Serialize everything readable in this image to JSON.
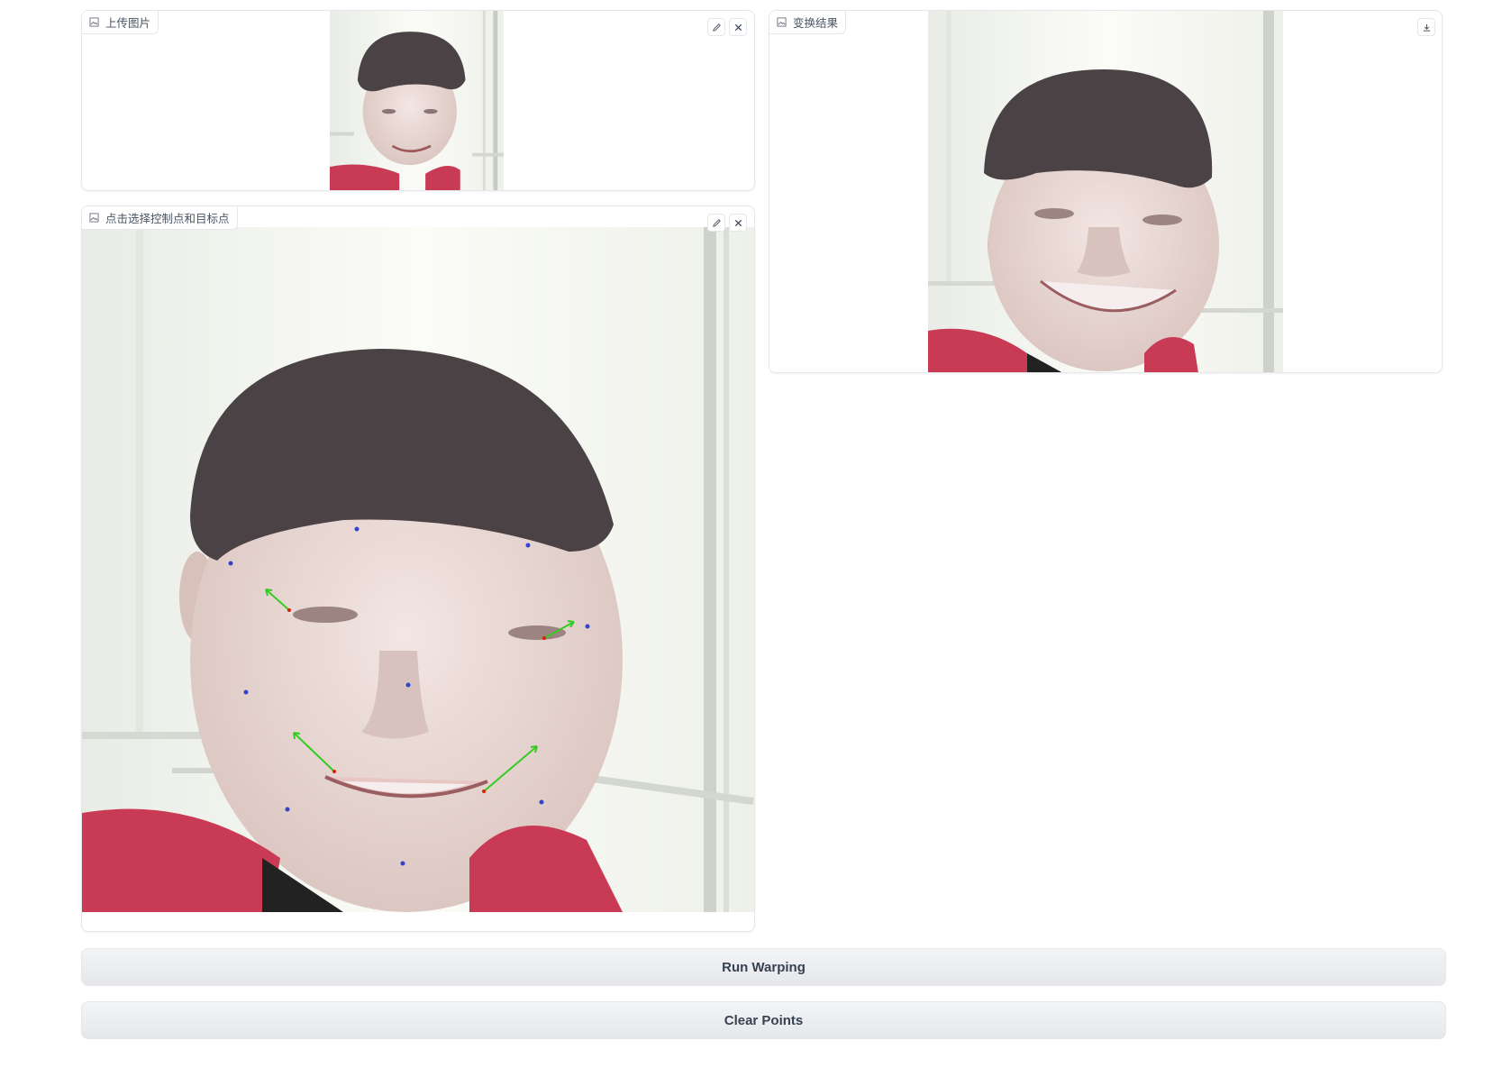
{
  "upload_panel": {
    "label": "上传图片"
  },
  "select_panel": {
    "label": "点击选择控制点和目标点"
  },
  "result_panel": {
    "label": "变换结果"
  },
  "buttons": {
    "run": "Run Warping",
    "clear": "Clear Points"
  },
  "colors": {
    "shirt": "#c93a55",
    "point_blue": "#3344cc",
    "arrow_green": "#33cc22",
    "point_red": "#dd2200"
  }
}
